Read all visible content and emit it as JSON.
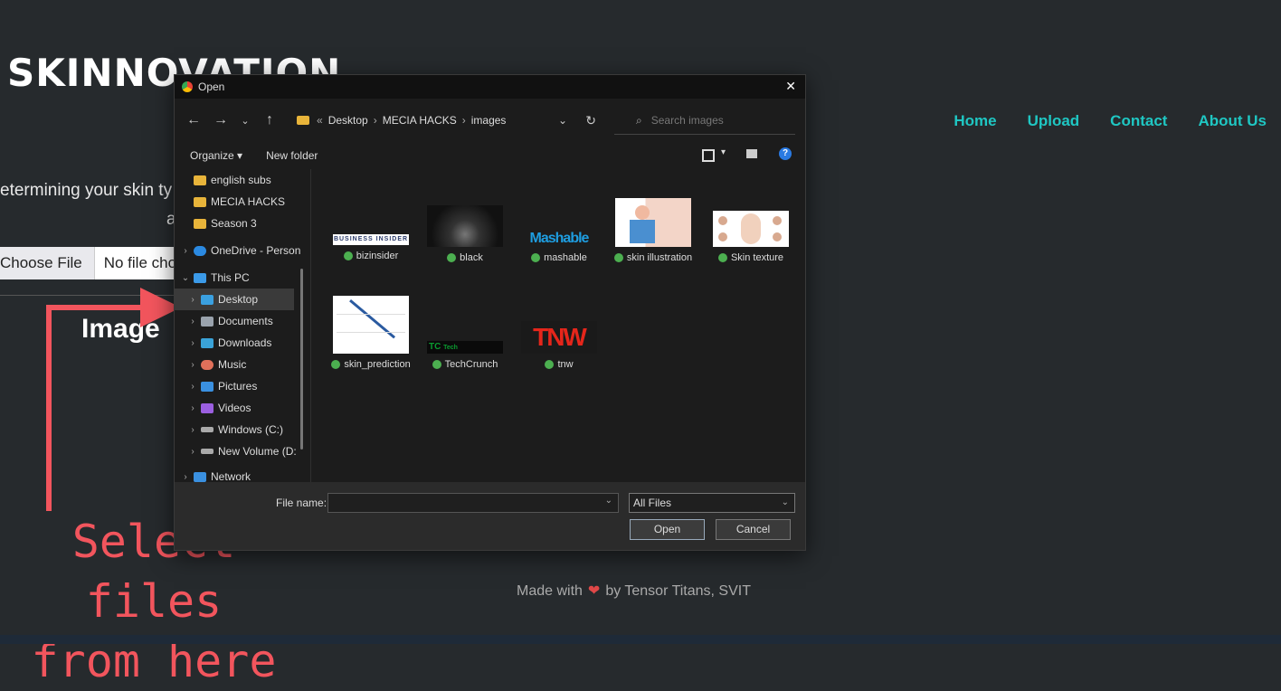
{
  "site": {
    "logo": "SKINNOVATION",
    "nav": [
      "Home",
      "Upload",
      "Contact",
      "About Us"
    ],
    "intro_line1": "etermining your skin ty",
    "intro_line2": "a",
    "choose_file": "Choose File",
    "no_file": "No file chos",
    "image_heading": "Image",
    "annotation_line1": "Select files",
    "annotation_line2": "from here",
    "footer_pre": "Made with",
    "footer_post": "by Tensor Titans, SVIT"
  },
  "dialog": {
    "title": "Open",
    "close": "✕",
    "breadcrumb": [
      "Desktop",
      "MECIA HACKS",
      "images"
    ],
    "search_placeholder": "Search images",
    "toolbar": {
      "organize": "Organize ▾",
      "new_folder": "New folder",
      "help": "?"
    },
    "sidebar": [
      {
        "label": "english subs",
        "icon": "folder-icon",
        "color": "#e8b43a"
      },
      {
        "label": "MECIA HACKS",
        "icon": "folder-icon",
        "color": "#e8b43a"
      },
      {
        "label": "Season 3",
        "icon": "folder-icon",
        "color": "#e8b43a"
      },
      {
        "label": "OneDrive - Person",
        "icon": "cloud-icon",
        "color": "#2b8ae2"
      },
      {
        "label": "This PC",
        "icon": "computer-icon",
        "color": "#3b9ae8"
      },
      {
        "label": "Desktop",
        "icon": "desktop-icon",
        "color": "#3aa0e0"
      },
      {
        "label": "Documents",
        "icon": "documents-icon",
        "color": "#9aa3ad"
      },
      {
        "label": "Downloads",
        "icon": "download-icon",
        "color": "#3aa3d8"
      },
      {
        "label": "Music",
        "icon": "music-icon",
        "color": "#e0705a"
      },
      {
        "label": "Pictures",
        "icon": "pictures-icon",
        "color": "#3a90e0"
      },
      {
        "label": "Videos",
        "icon": "videos-icon",
        "color": "#9b5fe0"
      },
      {
        "label": "Windows (C:)",
        "icon": "drive-icon",
        "color": "#aaa"
      },
      {
        "label": "New Volume (D:",
        "icon": "drive-icon",
        "color": "#aaa"
      },
      {
        "label": "Network",
        "icon": "network-icon",
        "color": "#3a90e0"
      }
    ],
    "files": [
      {
        "name": "bizinsider"
      },
      {
        "name": "black"
      },
      {
        "name": "mashable"
      },
      {
        "name": "skin illustration"
      },
      {
        "name": "Skin texture"
      },
      {
        "name": "skin_prediction"
      },
      {
        "name": "TechCrunch"
      },
      {
        "name": "tnw"
      }
    ],
    "thumb_text": {
      "bizinsider": "BUSINESS INSIDER",
      "mashable": "Mashable",
      "techcrunch_logo": "TC",
      "techcrunch_word": "Tech",
      "tnw": "TNW"
    },
    "file_name_label": "File name:",
    "file_name_value": "",
    "file_type": "All Files",
    "open_button": "Open",
    "cancel_button": "Cancel"
  }
}
